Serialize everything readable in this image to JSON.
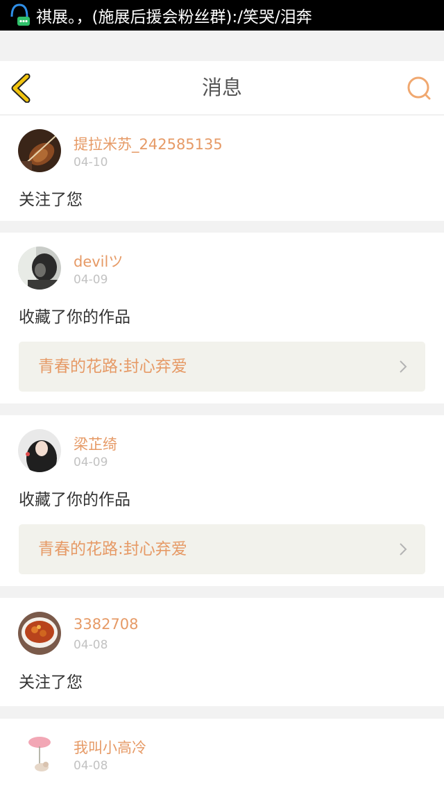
{
  "statusbar": {
    "ticker_text": "祺展。，(施展后援会粉丝群):/笑哭/泪奔",
    "app_icon": "qq-notification-icon"
  },
  "header": {
    "title": "消息",
    "back_icon": "back-chevron-icon",
    "search_icon": "search-icon"
  },
  "colors": {
    "accent": "#e69a66",
    "back_icon": "#f2c40f",
    "date": "#c2c2c2",
    "work_bg": "#f2f2ec"
  },
  "messages": [
    {
      "user": "提拉米苏_242585135",
      "date": "04-10",
      "action": "关注了您",
      "avatar": "violin-avatar"
    },
    {
      "user": "devilツ",
      "date": "04-09",
      "action": "收藏了你的作品",
      "work": "青春的花路:封心弃爱",
      "avatar": "dark-portrait-avatar"
    },
    {
      "user": "梁芷绮",
      "date": "04-09",
      "action": "收藏了你的作品",
      "work": "青春的花路:封心弃爱",
      "avatar": "girl-portrait-avatar"
    },
    {
      "user": "3382708",
      "date": "04-08",
      "action": "关注了您",
      "avatar": "food-bowl-avatar"
    },
    {
      "user": "我叫小高冷",
      "date": "04-08",
      "avatar": "lotus-illustration-avatar"
    }
  ]
}
